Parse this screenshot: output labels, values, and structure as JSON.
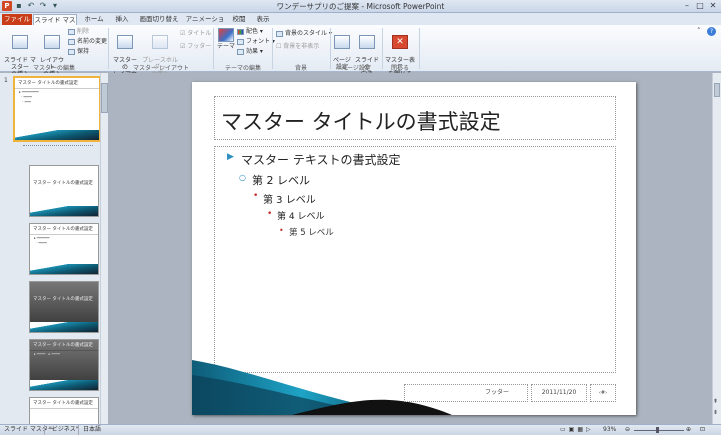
{
  "titlebar": {
    "app_icon": "P",
    "title": "ワンデーサプリのご提案 - Microsoft PowerPoint",
    "qat_icons": [
      "save-icon",
      "undo-icon",
      "redo-icon",
      "customize-icon"
    ],
    "win_buttons": [
      "–",
      "□",
      "✕"
    ]
  },
  "tabs": [
    {
      "label": "ファイル"
    },
    {
      "label": "スライド マスター"
    },
    {
      "label": "ホーム"
    },
    {
      "label": "挿入"
    },
    {
      "label": "画面切り替え"
    },
    {
      "label": "アニメーション"
    },
    {
      "label": "校閲"
    },
    {
      "label": "表示"
    }
  ],
  "ribbon": {
    "edit_master": {
      "group": "マスターの編集",
      "insert_slide_master": "スライド マスター\nの挿入",
      "insert_layout": "レイアウト\nの挿入",
      "delete": "削除",
      "rename": "名前の変更",
      "preserve": "保持"
    },
    "master_layout": {
      "group": "マスター レイアウト",
      "master_layout_btn": "マスターの\nレイアウト",
      "insert_placeholder": "プレースホルダー\nの挿入",
      "title_chk": "タイトル",
      "footer_chk": "フッター"
    },
    "edit_theme": {
      "group": "テーマの編集",
      "themes": "テーマ",
      "colors": "配色",
      "fonts": "フォント",
      "effects": "効果"
    },
    "background": {
      "group": "背景",
      "bg_styles": "背景のスタイル",
      "hide_bg": "背景を非表示"
    },
    "page_setup": {
      "group": "ページ設定",
      "page_setup_btn": "ページ\n設定",
      "orientation": "スライドの\n向き"
    },
    "close": {
      "group": "閉じる",
      "close_master": "マスター表示\nを閉じる"
    }
  },
  "thumbnails": [
    {
      "num": "1",
      "title": "マスター タイトルの書式設定"
    },
    {
      "num": "",
      "title": "マスター タイトルの書式設定"
    },
    {
      "num": "",
      "title": "マスター タイトルの書式設定"
    },
    {
      "num": "",
      "title": "マスター タイトルの書式設定"
    },
    {
      "num": "",
      "title": "マスター タイトルの書式設定"
    },
    {
      "num": "",
      "title": "マスター タイトルの書式設定"
    }
  ],
  "slide": {
    "title": "マスター タイトルの書式設定",
    "levels": [
      "マスター テキストの書式設定",
      "第 2 レベル",
      "第 3 レベル",
      "第 4 レベル",
      "第 5 レベル"
    ],
    "footer": "フッター",
    "date": "2011/11/20",
    "page_num": "‹#›"
  },
  "statusbar": {
    "view": "スライド マスター",
    "theme": "\"ビジネス\"",
    "language": "日本語",
    "zoom": "93%"
  },
  "colors": {
    "accent": "#1b8fb0",
    "file_tab": "#c93d18",
    "selected_thumb": "#f0b33c"
  }
}
